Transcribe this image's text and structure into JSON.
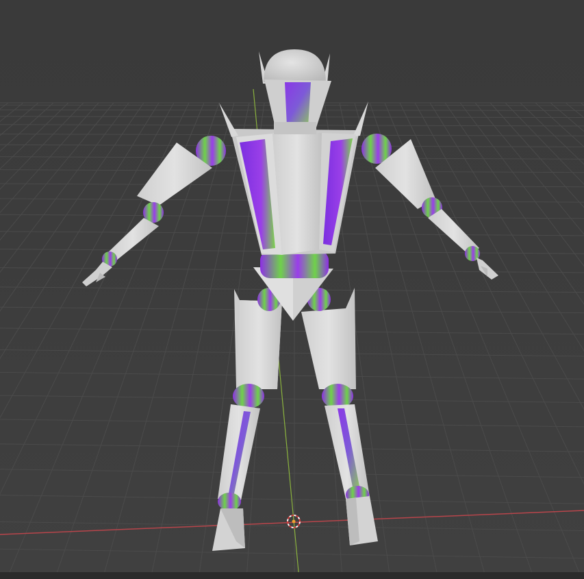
{
  "viewport": {
    "type": "3d-viewport",
    "background": "#3d3d3d",
    "grid_color": "#4b4b4b",
    "x_axis_color": "#b8454b",
    "y_axis_color": "#8bb33e"
  },
  "model": {
    "surface_color": "#d6d6d6",
    "accent_colors": [
      "#8d34e0",
      "#7bd44a"
    ]
  },
  "icons": {
    "cursor": "3d-cursor-icon"
  }
}
